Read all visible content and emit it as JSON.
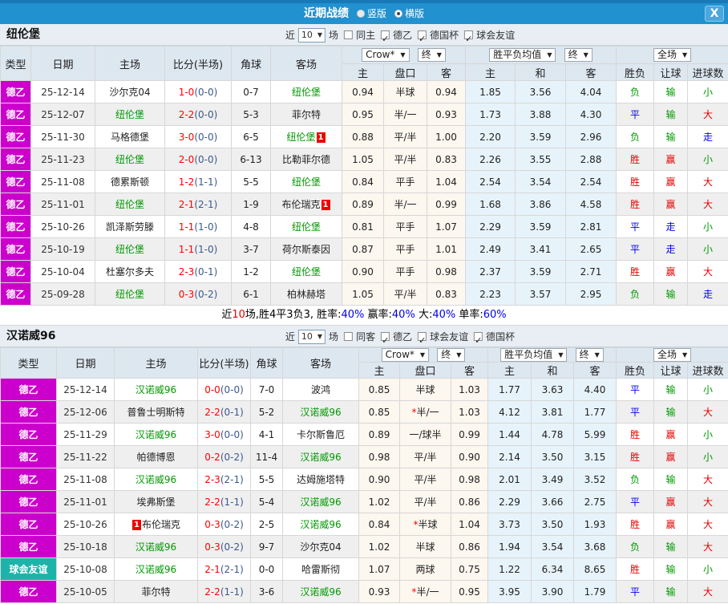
{
  "titlebar": {
    "title": "近期战绩",
    "vertical_label": "竖版",
    "horizontal_label": "横版",
    "close_glyph": "X"
  },
  "columns": {
    "type": "类型",
    "date": "日期",
    "home": "主场",
    "score": "比分(半场)",
    "corner": "角球",
    "away": "客场",
    "odds_home": "主",
    "handicap": "盘口",
    "odds_away": "客",
    "avg_home": "主",
    "avg_draw": "和",
    "avg_away": "客",
    "result": "胜负",
    "handicap_result": "让球",
    "goals": "进球数"
  },
  "controls": {
    "odds_source": "Crow*",
    "final_label": "终",
    "avg_label": "胜平负均值",
    "scope_label": "全场",
    "arrow": "▼"
  },
  "sections": [
    {
      "team": "纽伦堡",
      "filter": {
        "near": "近",
        "count": "10",
        "games": "场",
        "same_label": "同主",
        "same_checked": false,
        "leagues": [
          "德乙",
          "德国杯",
          "球会友谊"
        ]
      },
      "rows": [
        {
          "type": "德乙",
          "tcolor": "m",
          "date": "25-12-14",
          "home": "沙尔克04",
          "hfocal": false,
          "score": "1-0",
          "half": "(0-0)",
          "corner": "0-7",
          "away": "纽伦堡",
          "afocal": true,
          "o1": "0.94",
          "hcap": "半球",
          "star": false,
          "o2": "0.94",
          "a1": "1.85",
          "a2": "3.56",
          "a3": "4.04",
          "res": [
            "负",
            "g"
          ],
          "hres": [
            "输",
            "g"
          ],
          "gres": [
            "小",
            "g"
          ]
        },
        {
          "type": "德乙",
          "tcolor": "m",
          "date": "25-12-07",
          "home": "纽伦堡",
          "hfocal": true,
          "score": "2-2",
          "half": "(0-0)",
          "corner": "5-3",
          "away": "菲尔特",
          "afocal": false,
          "o1": "0.95",
          "hcap": "半/一",
          "star": false,
          "o2": "0.93",
          "a1": "1.73",
          "a2": "3.88",
          "a3": "4.30",
          "res": [
            "平",
            "b"
          ],
          "hres": [
            "输",
            "g"
          ],
          "gres": [
            "大",
            "r"
          ]
        },
        {
          "type": "德乙",
          "tcolor": "m",
          "date": "25-11-30",
          "home": "马格德堡",
          "hfocal": false,
          "score": "3-0",
          "half": "(0-0)",
          "corner": "6-5",
          "away": "纽伦堡",
          "afocal": true,
          "abadge": "1",
          "o1": "0.88",
          "hcap": "平/半",
          "star": false,
          "o2": "1.00",
          "a1": "2.20",
          "a2": "3.59",
          "a3": "2.96",
          "res": [
            "负",
            "g"
          ],
          "hres": [
            "输",
            "g"
          ],
          "gres": [
            "走",
            "b"
          ]
        },
        {
          "type": "德乙",
          "tcolor": "m",
          "date": "25-11-23",
          "home": "纽伦堡",
          "hfocal": true,
          "score": "2-0",
          "half": "(0-0)",
          "corner": "6-13",
          "away": "比勒菲尔德",
          "afocal": false,
          "o1": "1.05",
          "hcap": "平/半",
          "star": false,
          "o2": "0.83",
          "a1": "2.26",
          "a2": "3.55",
          "a3": "2.88",
          "res": [
            "胜",
            "r"
          ],
          "hres": [
            "赢",
            "r"
          ],
          "gres": [
            "小",
            "g"
          ]
        },
        {
          "type": "德乙",
          "tcolor": "m",
          "date": "25-11-08",
          "home": "德累斯顿",
          "hfocal": false,
          "score": "1-2",
          "half": "(1-1)",
          "corner": "5-5",
          "away": "纽伦堡",
          "afocal": true,
          "o1": "0.84",
          "hcap": "平手",
          "star": false,
          "o2": "1.04",
          "a1": "2.54",
          "a2": "3.54",
          "a3": "2.54",
          "res": [
            "胜",
            "r"
          ],
          "hres": [
            "赢",
            "r"
          ],
          "gres": [
            "大",
            "r"
          ]
        },
        {
          "type": "德乙",
          "tcolor": "m",
          "date": "25-11-01",
          "home": "纽伦堡",
          "hfocal": true,
          "score": "2-1",
          "half": "(2-1)",
          "corner": "1-9",
          "away": "布伦瑞克",
          "afocal": false,
          "abadge": "1",
          "o1": "0.89",
          "hcap": "半/一",
          "star": false,
          "o2": "0.99",
          "a1": "1.68",
          "a2": "3.86",
          "a3": "4.58",
          "res": [
            "胜",
            "r"
          ],
          "hres": [
            "赢",
            "r"
          ],
          "gres": [
            "大",
            "r"
          ]
        },
        {
          "type": "德乙",
          "tcolor": "m",
          "date": "25-10-26",
          "home": "凯泽斯劳滕",
          "hfocal": false,
          "score": "1-1",
          "half": "(1-0)",
          "corner": "4-8",
          "away": "纽伦堡",
          "afocal": true,
          "o1": "0.81",
          "hcap": "平手",
          "star": false,
          "o2": "1.07",
          "a1": "2.29",
          "a2": "3.59",
          "a3": "2.81",
          "res": [
            "平",
            "b"
          ],
          "hres": [
            "走",
            "b"
          ],
          "gres": [
            "小",
            "g"
          ]
        },
        {
          "type": "德乙",
          "tcolor": "m",
          "date": "25-10-19",
          "home": "纽伦堡",
          "hfocal": true,
          "score": "1-1",
          "half": "(1-0)",
          "corner": "3-7",
          "away": "荷尔斯泰因",
          "afocal": false,
          "o1": "0.87",
          "hcap": "平手",
          "star": false,
          "o2": "1.01",
          "a1": "2.49",
          "a2": "3.41",
          "a3": "2.65",
          "res": [
            "平",
            "b"
          ],
          "hres": [
            "走",
            "b"
          ],
          "gres": [
            "小",
            "g"
          ]
        },
        {
          "type": "德乙",
          "tcolor": "m",
          "date": "25-10-04",
          "home": "杜塞尔多夫",
          "hfocal": false,
          "score": "2-3",
          "half": "(0-1)",
          "corner": "1-2",
          "away": "纽伦堡",
          "afocal": true,
          "o1": "0.90",
          "hcap": "平手",
          "star": false,
          "o2": "0.98",
          "a1": "2.37",
          "a2": "3.59",
          "a3": "2.71",
          "res": [
            "胜",
            "r"
          ],
          "hres": [
            "赢",
            "r"
          ],
          "gres": [
            "大",
            "r"
          ]
        },
        {
          "type": "德乙",
          "tcolor": "m",
          "date": "25-09-28",
          "home": "纽伦堡",
          "hfocal": true,
          "score": "0-3",
          "half": "(0-2)",
          "corner": "6-1",
          "away": "柏林赫塔",
          "afocal": false,
          "o1": "1.05",
          "hcap": "平/半",
          "star": false,
          "o2": "0.83",
          "a1": "2.23",
          "a2": "3.57",
          "a3": "2.95",
          "res": [
            "负",
            "g"
          ],
          "hres": [
            "输",
            "g"
          ],
          "gres": [
            "走",
            "b"
          ]
        }
      ],
      "summary": [
        {
          "t": "近",
          "c": "k"
        },
        {
          "t": "10",
          "c": "r"
        },
        {
          "t": "场,胜4平3负3, 胜率:",
          "c": "k"
        },
        {
          "t": "40%",
          "c": "b"
        },
        {
          "t": " 赢率:",
          "c": "k"
        },
        {
          "t": "40%",
          "c": "b"
        },
        {
          "t": " 大:",
          "c": "k"
        },
        {
          "t": "40%",
          "c": "b"
        },
        {
          "t": " 单率:",
          "c": "k"
        },
        {
          "t": "60%",
          "c": "b"
        }
      ]
    },
    {
      "team": "汉诺威96",
      "filter": {
        "near": "近",
        "count": "10",
        "games": "场",
        "same_label": "同客",
        "same_checked": false,
        "leagues": [
          "德乙",
          "球会友谊",
          "德国杯"
        ]
      },
      "rows": [
        {
          "type": "德乙",
          "tcolor": "m",
          "date": "25-12-14",
          "home": "汉诺威96",
          "hfocal": true,
          "score": "0-0",
          "half": "(0-0)",
          "corner": "7-0",
          "away": "波鸿",
          "afocal": false,
          "o1": "0.85",
          "hcap": "半球",
          "star": false,
          "o2": "1.03",
          "a1": "1.77",
          "a2": "3.63",
          "a3": "4.40",
          "res": [
            "平",
            "b"
          ],
          "hres": [
            "输",
            "g"
          ],
          "gres": [
            "小",
            "g"
          ]
        },
        {
          "type": "德乙",
          "tcolor": "m",
          "date": "25-12-06",
          "home": "普鲁士明斯特",
          "hfocal": false,
          "score": "2-2",
          "half": "(0-1)",
          "corner": "5-2",
          "away": "汉诺威96",
          "afocal": true,
          "o1": "0.85",
          "hcap": "半/一",
          "star": true,
          "o2": "1.03",
          "a1": "4.12",
          "a2": "3.81",
          "a3": "1.77",
          "res": [
            "平",
            "b"
          ],
          "hres": [
            "输",
            "g"
          ],
          "gres": [
            "大",
            "r"
          ]
        },
        {
          "type": "德乙",
          "tcolor": "m",
          "date": "25-11-29",
          "home": "汉诺威96",
          "hfocal": true,
          "score": "3-0",
          "half": "(0-0)",
          "corner": "4-1",
          "away": "卡尔斯鲁厄",
          "afocal": false,
          "o1": "0.89",
          "hcap": "一/球半",
          "star": false,
          "o2": "0.99",
          "a1": "1.44",
          "a2": "4.78",
          "a3": "5.99",
          "res": [
            "胜",
            "r"
          ],
          "hres": [
            "赢",
            "r"
          ],
          "gres": [
            "小",
            "g"
          ]
        },
        {
          "type": "德乙",
          "tcolor": "m",
          "date": "25-11-22",
          "home": "帕德博恩",
          "hfocal": false,
          "score": "0-2",
          "half": "(0-2)",
          "corner": "11-4",
          "away": "汉诺威96",
          "afocal": true,
          "o1": "0.98",
          "hcap": "平/半",
          "star": false,
          "o2": "0.90",
          "a1": "2.14",
          "a2": "3.50",
          "a3": "3.15",
          "res": [
            "胜",
            "r"
          ],
          "hres": [
            "赢",
            "r"
          ],
          "gres": [
            "小",
            "g"
          ]
        },
        {
          "type": "德乙",
          "tcolor": "m",
          "date": "25-11-08",
          "home": "汉诺威96",
          "hfocal": true,
          "score": "2-3",
          "half": "(2-1)",
          "corner": "5-5",
          "away": "达姆施塔特",
          "afocal": false,
          "o1": "0.90",
          "hcap": "平/半",
          "star": false,
          "o2": "0.98",
          "a1": "2.01",
          "a2": "3.49",
          "a3": "3.52",
          "res": [
            "负",
            "g"
          ],
          "hres": [
            "输",
            "g"
          ],
          "gres": [
            "大",
            "r"
          ]
        },
        {
          "type": "德乙",
          "tcolor": "m",
          "date": "25-11-01",
          "home": "埃弗斯堡",
          "hfocal": false,
          "score": "2-2",
          "half": "(1-1)",
          "corner": "5-4",
          "away": "汉诺威96",
          "afocal": true,
          "o1": "1.02",
          "hcap": "平/半",
          "star": false,
          "o2": "0.86",
          "a1": "2.29",
          "a2": "3.66",
          "a3": "2.75",
          "res": [
            "平",
            "b"
          ],
          "hres": [
            "赢",
            "r"
          ],
          "gres": [
            "大",
            "r"
          ]
        },
        {
          "type": "德乙",
          "tcolor": "m",
          "date": "25-10-26",
          "home": "布伦瑞克",
          "hfocal": false,
          "hbadge": "1",
          "score": "0-3",
          "half": "(0-2)",
          "corner": "2-5",
          "away": "汉诺威96",
          "afocal": true,
          "o1": "0.84",
          "hcap": "半球",
          "star": true,
          "o2": "1.04",
          "a1": "3.73",
          "a2": "3.50",
          "a3": "1.93",
          "res": [
            "胜",
            "r"
          ],
          "hres": [
            "赢",
            "r"
          ],
          "gres": [
            "大",
            "r"
          ]
        },
        {
          "type": "德乙",
          "tcolor": "m",
          "date": "25-10-18",
          "home": "汉诺威96",
          "hfocal": true,
          "score": "0-3",
          "half": "(0-2)",
          "corner": "9-7",
          "away": "沙尔克04",
          "afocal": false,
          "o1": "1.02",
          "hcap": "半球",
          "star": false,
          "o2": "0.86",
          "a1": "1.94",
          "a2": "3.54",
          "a3": "3.68",
          "res": [
            "负",
            "g"
          ],
          "hres": [
            "输",
            "g"
          ],
          "gres": [
            "大",
            "r"
          ]
        },
        {
          "type": "球会友谊",
          "tcolor": "t",
          "date": "25-10-08",
          "home": "汉诺威96",
          "hfocal": true,
          "score": "2-1",
          "half": "(2-1)",
          "corner": "0-0",
          "away": "哈雷斯彻",
          "afocal": false,
          "o1": "1.07",
          "hcap": "两球",
          "star": false,
          "o2": "0.75",
          "a1": "1.22",
          "a2": "6.34",
          "a3": "8.65",
          "res": [
            "胜",
            "r"
          ],
          "hres": [
            "输",
            "g"
          ],
          "gres": [
            "小",
            "g"
          ]
        },
        {
          "type": "德乙",
          "tcolor": "m",
          "date": "25-10-05",
          "home": "菲尔特",
          "hfocal": false,
          "score": "2-2",
          "half": "(1-1)",
          "corner": "3-6",
          "away": "汉诺威96",
          "afocal": true,
          "o1": "0.93",
          "hcap": "半/一",
          "star": true,
          "o2": "0.95",
          "a1": "3.95",
          "a2": "3.90",
          "a3": "1.79",
          "res": [
            "平",
            "b"
          ],
          "hres": [
            "输",
            "g"
          ],
          "gres": [
            "大",
            "r"
          ]
        }
      ],
      "summary": []
    }
  ]
}
